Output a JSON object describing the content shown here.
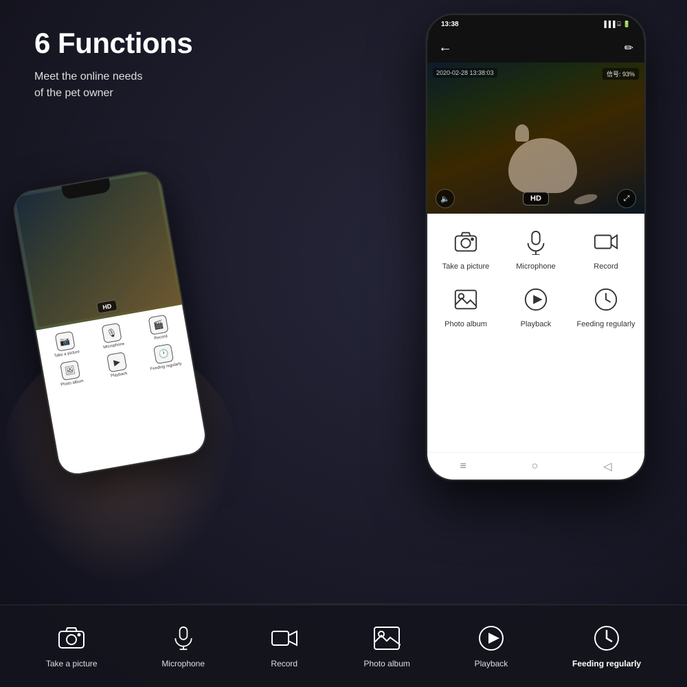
{
  "page": {
    "background_color": "#1a1a2e"
  },
  "heading": {
    "title": "6 Functions",
    "subtitle_line1": "Meet the online needs",
    "subtitle_line2": "of the pet owner"
  },
  "phone_main": {
    "status_bar": {
      "time": "13:38",
      "signal": "信号: 93%"
    },
    "video": {
      "timestamp": "2020-02-28 13:38:03",
      "hd_label": "HD"
    },
    "functions": [
      {
        "label": "Take a picture",
        "icon": "camera"
      },
      {
        "label": "Microphone",
        "icon": "microphone"
      },
      {
        "label": "Record",
        "icon": "record"
      },
      {
        "label": "Photo album",
        "icon": "photo"
      },
      {
        "label": "Playback",
        "icon": "playback"
      },
      {
        "label": "Feeding regularly",
        "icon": "clock"
      }
    ],
    "nav": [
      "≡",
      "○",
      "◁"
    ]
  },
  "bottom_bar": {
    "functions": [
      {
        "label": "Take a picture",
        "icon": "camera",
        "bold": false
      },
      {
        "label": "Microphone",
        "icon": "microphone",
        "bold": false
      },
      {
        "label": "Record",
        "icon": "record",
        "bold": false
      },
      {
        "label": "Photo album",
        "icon": "photo",
        "bold": false
      },
      {
        "label": "Playback",
        "icon": "playback",
        "bold": false
      },
      {
        "label": "Feeding regularly",
        "icon": "clock",
        "bold": true
      }
    ]
  }
}
